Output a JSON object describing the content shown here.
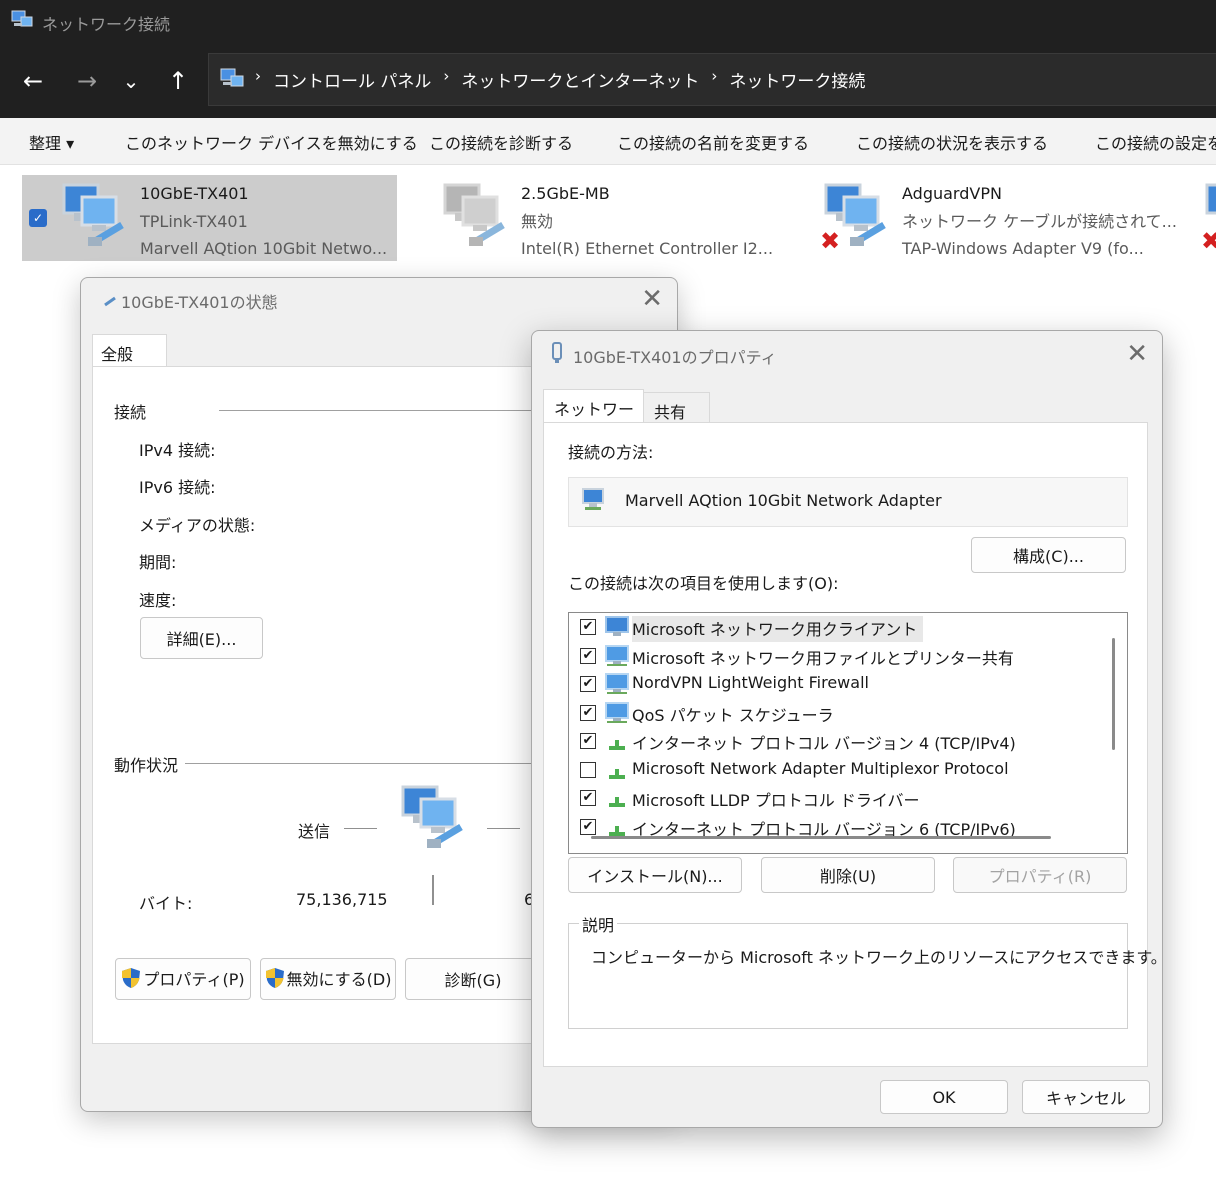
{
  "window": {
    "title": "ネットワーク接続"
  },
  "nav": {
    "back": "←",
    "forward": "→",
    "recent": "⌄",
    "up": "↑"
  },
  "breadcrumb": {
    "sep": "›",
    "items": [
      "コントロール パネル",
      "ネットワークとインターネット",
      "ネットワーク接続"
    ]
  },
  "commands": {
    "organize": "整理 ▾",
    "disable": "このネットワーク デバイスを無効にする",
    "diagnose": "この接続を診断する",
    "rename": "この接続の名前を変更する",
    "status": "この接続の状況を表示する",
    "settings": "この接続の設定を"
  },
  "connections": [
    {
      "name": "10GbE-TX401",
      "status": "TPLink-TX401",
      "device": "Marvell AQtion 10Gbit Netwo..."
    },
    {
      "name": "2.5GbE-MB",
      "status": "無効",
      "device": "Intel(R) Ethernet Controller I2..."
    },
    {
      "name": "AdguardVPN",
      "status": "ネットワーク ケーブルが接続されて...",
      "device": "TAP-Windows Adapter V9 (fo..."
    }
  ],
  "status_dialog": {
    "title": "10GbE-TX401の状態",
    "tab": "全般",
    "connection_group": "接続",
    "ipv4": "IPv4 接続:",
    "ipv6": "IPv6 接続:",
    "media": "メディアの状態:",
    "duration": "期間:",
    "speed": "速度:",
    "details_button": "詳細(E)...",
    "activity_group": "動作状況",
    "sent": "送信",
    "bytes_label": "バイト:",
    "bytes_sent": "75,136,715",
    "bytes_received_partial": "6",
    "properties_button": "プロパティ(P)",
    "disable_button": "無効にする(D)",
    "diagnose_button": "診断(G)"
  },
  "properties_dialog": {
    "title": "10GbE-TX401のプロパティ",
    "tabs": [
      "ネットワーク",
      "共有"
    ],
    "connect_using": "接続の方法:",
    "adapter": "Marvell AQtion 10Gbit Network Adapter",
    "configure_button": "構成(C)...",
    "items_label": "この接続は次の項目を使用します(O):",
    "items": [
      {
        "label": "Microsoft ネットワーク用クライアント",
        "checked": true,
        "icon": "network-client-icon"
      },
      {
        "label": "Microsoft ネットワーク用ファイルとプリンター共有",
        "checked": true,
        "icon": "network-service-icon"
      },
      {
        "label": "NordVPN LightWeight Firewall",
        "checked": true,
        "icon": "network-service-icon"
      },
      {
        "label": "QoS パケット スケジューラ",
        "checked": true,
        "icon": "network-service-icon"
      },
      {
        "label": "インターネット プロトコル バージョン 4 (TCP/IPv4)",
        "checked": true,
        "icon": "protocol-icon"
      },
      {
        "label": "Microsoft Network Adapter Multiplexor Protocol",
        "checked": false,
        "icon": "protocol-icon"
      },
      {
        "label": "Microsoft LLDP プロトコル ドライバー",
        "checked": true,
        "icon": "protocol-icon"
      },
      {
        "label": "インターネット プロトコル バージョン 6 (TCP/IPv6)",
        "checked": true,
        "icon": "protocol-icon"
      }
    ],
    "install_button": "インストール(N)...",
    "uninstall_button": "削除(U)",
    "properties_button": "プロパティ(R)",
    "description_label": "説明",
    "description": "コンピューターから Microsoft ネットワーク上のリソースにアクセスできます。",
    "ok_button": "OK",
    "cancel_button": "キャンセル"
  },
  "colors": {
    "accent": "#2a6cc9",
    "dark_chrome": "#202020",
    "selection": "#cccccc",
    "error_red": "#d42020"
  }
}
